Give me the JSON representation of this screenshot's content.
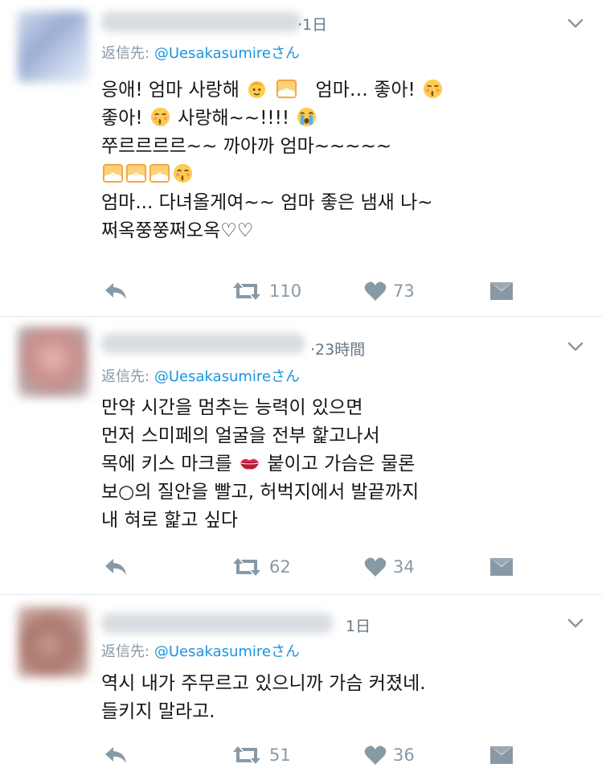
{
  "tweets": [
    {
      "time": "·1日",
      "reply_prefix": "返信先:",
      "reply_handle": "@Uesakasumire",
      "reply_suffix": "さん",
      "lines": [
        [
          "응애! 엄마 사랑해",
          "  엄마… 좋아!"
        ],
        [
          "좋아!",
          " 사랑해~~!!!! "
        ],
        [
          "쭈르르르르~~ 까아까 엄마~~~~~"
        ],
        [
          ""
        ],
        [
          "엄마... 다녀올게여~~ 엄마 좋은 냄새 나~"
        ],
        [
          "쩌옥쭝쭝쩌오옥♡♡"
        ]
      ],
      "retweets": "110",
      "likes": "73"
    },
    {
      "time": "·23時間",
      "reply_prefix": "返信先:",
      "reply_handle": "@Uesakasumire",
      "reply_suffix": "さん",
      "lines": [
        [
          "만약 시간을 멈추는 능력이 있으면"
        ],
        [
          "먼저 스미페의 얼굴을 전부 핥고나서"
        ],
        [
          "목에 키스 마크를 ",
          " 붙이고 가슴은 물론"
        ],
        [
          "보○의 질안을 빨고, 허벅지에서 발끝까지"
        ],
        [
          "내 혀로 핥고 싶다"
        ]
      ],
      "retweets": "62",
      "likes": "34"
    },
    {
      "time": "1日",
      "reply_prefix": "返信先:",
      "reply_handle": "@Uesakasumire",
      "reply_suffix": "さん",
      "lines": [
        [
          "역시 내가 주무르고 있으니까 가슴 커졌네."
        ],
        [
          "들키지 말라고."
        ]
      ],
      "retweets": "51",
      "likes": "36"
    }
  ],
  "icons": {
    "reply": "reply-icon",
    "retweet": "retweet-icon",
    "like": "heart-icon",
    "dm": "envelope-icon",
    "more": "chevron-down-icon"
  },
  "colors": {
    "handle": "#1b95e0",
    "meta": "#8899a6",
    "text": "#14171a",
    "divider": "#e1e8ed"
  }
}
